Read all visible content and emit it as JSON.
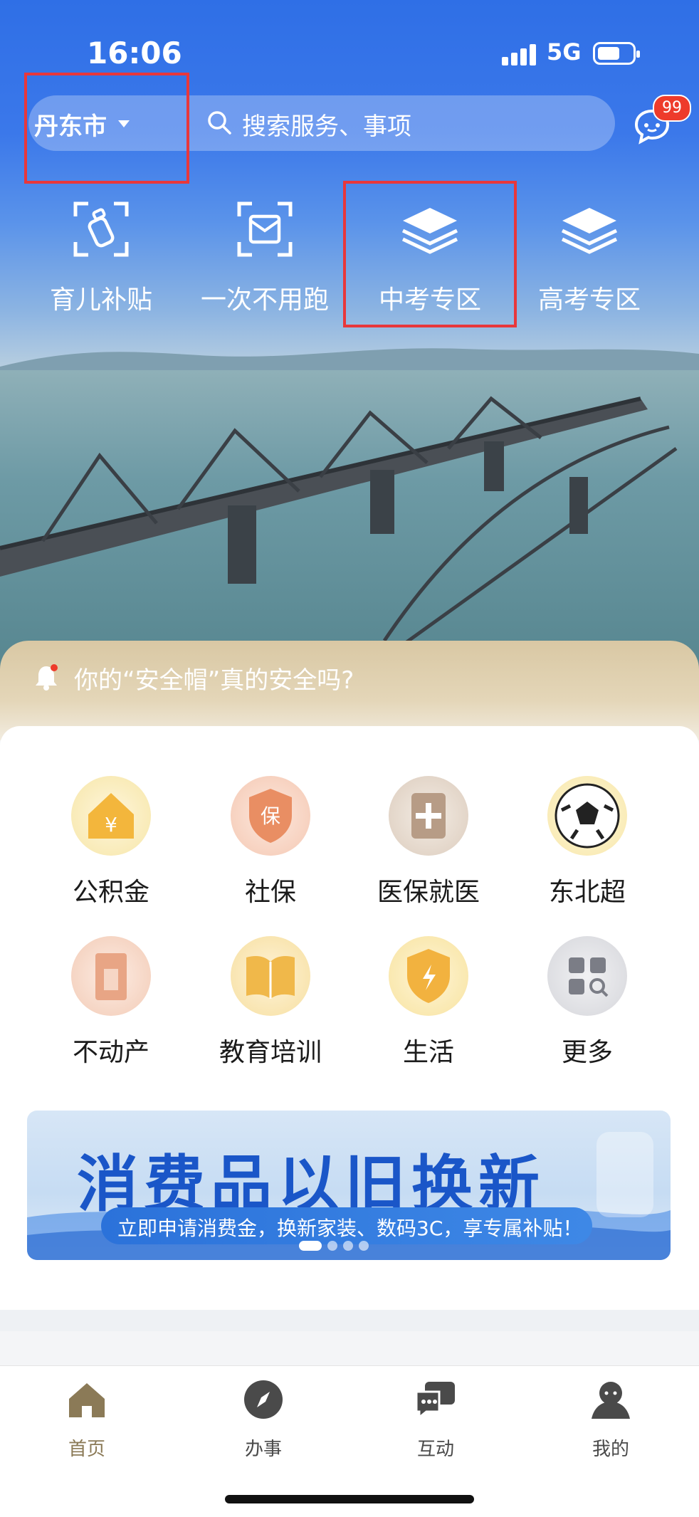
{
  "status": {
    "time": "16:06",
    "network": "5G"
  },
  "header": {
    "city": "丹东市",
    "search_placeholder": "搜索服务、事项",
    "chat_badge": "99"
  },
  "quick_links": [
    {
      "label": "育儿补贴",
      "icon": "scan-bottle-icon"
    },
    {
      "label": "一次不用跑",
      "icon": "scan-document-icon"
    },
    {
      "label": "中考专区",
      "icon": "zhongkao-stack-icon"
    },
    {
      "label": "高考专区",
      "icon": "gaokao-stack-icon"
    }
  ],
  "notice": {
    "text": "你的“安全帽”真的安全吗?"
  },
  "services": [
    {
      "label": "公积金",
      "icon": "house-fund-icon"
    },
    {
      "label": "社保",
      "icon": "social-security-shield-icon"
    },
    {
      "label": "医保就医",
      "icon": "medical-insurance-icon"
    },
    {
      "label": "东北超",
      "icon": "soccer-ball-icon"
    },
    {
      "label": "不动产",
      "icon": "real-estate-icon"
    },
    {
      "label": "教育培训",
      "icon": "open-book-icon"
    },
    {
      "label": "生活",
      "icon": "life-shield-icon"
    },
    {
      "label": "更多",
      "icon": "more-grid-icon"
    }
  ],
  "banner": {
    "title": "消费品以旧换新",
    "subtitle": "立即申请消费金，换新家装、数码3C，享专属补贴！"
  },
  "bottom_nav": [
    {
      "label": "首页",
      "icon": "home-icon",
      "active": true
    },
    {
      "label": "办事",
      "icon": "compass-icon",
      "active": false
    },
    {
      "label": "互动",
      "icon": "chat-bubbles-icon",
      "active": false
    },
    {
      "label": "我的",
      "icon": "profile-icon",
      "active": false
    }
  ],
  "colors": {
    "primary_blue": "#2f6fe6",
    "highlight_red": "#e8373b",
    "accent_gold": "#8b7a57",
    "badge_red": "#ee3b2b"
  }
}
